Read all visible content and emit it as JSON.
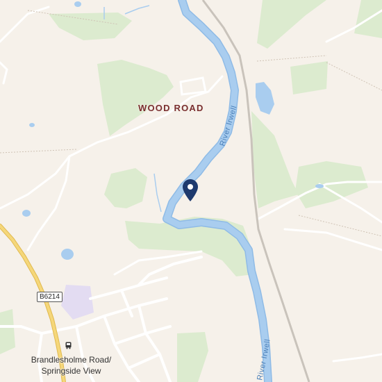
{
  "map": {
    "place_label": "WOOD ROAD",
    "river_label": "River Irwell",
    "road_shield": "B6214",
    "bus_stop": {
      "icon": "bus-icon",
      "line1": "Brandlesholme Road/",
      "line2": "Springside View"
    },
    "marker": {
      "icon": "map-pin-icon",
      "color": "#1e3a6e"
    },
    "colors": {
      "land": "#f6f1ea",
      "park": "#dcebcf",
      "water": "#a9cdef",
      "water_outline": "#8fbbe6",
      "road": "#ffffff",
      "primary_road": "#f5d77a",
      "railway": "#c9c3bb",
      "residential": "#ece6df",
      "school": "#e3dcf2"
    }
  }
}
